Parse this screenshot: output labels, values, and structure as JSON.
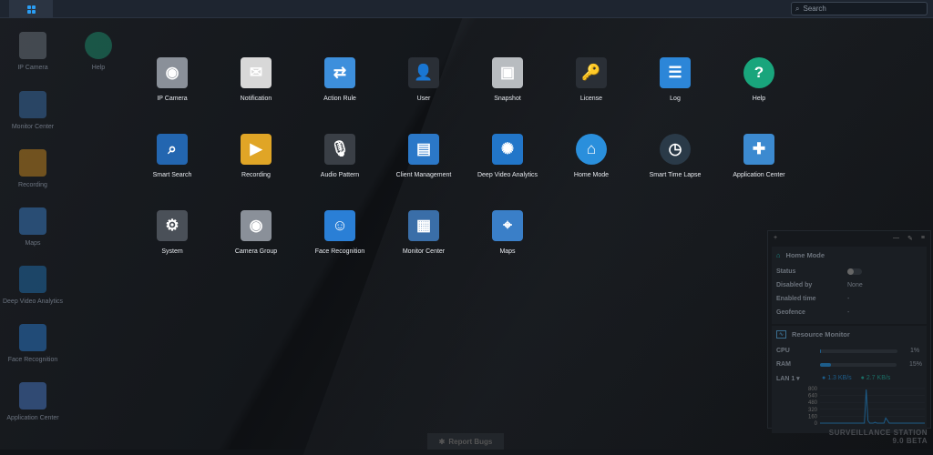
{
  "topbar": {
    "search_placeholder": "Search"
  },
  "desktop": [
    {
      "label": "IP Camera",
      "color": "#6e7680"
    },
    {
      "label": "Help",
      "color": "#1c8f6e"
    },
    {
      "label": "Monitor Center",
      "color": "#3a6ea8"
    },
    {
      "label": "Recording",
      "color": "#c9891e"
    },
    {
      "label": "Maps",
      "color": "#3a7fc8"
    },
    {
      "label": "Deep Video Analytics",
      "color": "#1f6fb0"
    },
    {
      "label": "Face Recognition",
      "color": "#2b7bd0"
    },
    {
      "label": "Application Center",
      "color": "#4a7ac8"
    }
  ],
  "apps": [
    {
      "label": "IP Camera",
      "color": "#8a9099",
      "glyph": "◉"
    },
    {
      "label": "Notification",
      "color": "#d8d8d8",
      "glyph": "✉"
    },
    {
      "label": "Action Rule",
      "color": "#3d8fdc",
      "glyph": "⇄"
    },
    {
      "label": "User",
      "color": "#2a2f36",
      "glyph": "👤"
    },
    {
      "label": "Snapshot",
      "color": "#b8bcc0",
      "glyph": "▣"
    },
    {
      "label": "License",
      "color": "#2a2f36",
      "glyph": "🔑"
    },
    {
      "label": "Log",
      "color": "#2c86d8",
      "glyph": "☰"
    },
    {
      "label": "Help",
      "color": "#19a57c",
      "glyph": "?"
    },
    {
      "label": "Smart Search",
      "color": "#2366b0",
      "glyph": "⌕"
    },
    {
      "label": "Recording",
      "color": "#e0a526",
      "glyph": "▶"
    },
    {
      "label": "Audio Pattern",
      "color": "#3a3f46",
      "glyph": "🎙"
    },
    {
      "label": "Client Management",
      "color": "#2b78c8",
      "glyph": "▤"
    },
    {
      "label": "Deep Video Analytics",
      "color": "#2276c9",
      "glyph": "✺"
    },
    {
      "label": "Home Mode",
      "color": "#2a8fdc",
      "glyph": "⌂"
    },
    {
      "label": "Smart Time Lapse",
      "color": "#2a3a48",
      "glyph": "◷"
    },
    {
      "label": "Application Center",
      "color": "#3c8ad0",
      "glyph": "✚"
    },
    {
      "label": "System",
      "color": "#4a5058",
      "glyph": "⚙"
    },
    {
      "label": "Camera Group",
      "color": "#8a9099",
      "glyph": "◉"
    },
    {
      "label": "Face Recognition",
      "color": "#2a7fd6",
      "glyph": "☺"
    },
    {
      "label": "Monitor Center",
      "color": "#3a6ea8",
      "glyph": "▦"
    },
    {
      "label": "Maps",
      "color": "#3a7fc8",
      "glyph": "⌖"
    }
  ],
  "widget": {
    "home_mode": {
      "title": "Home Mode",
      "rows": [
        {
          "k": "Status",
          "v": ""
        },
        {
          "k": "Disabled by",
          "v": "None"
        },
        {
          "k": "Enabled time",
          "v": "-"
        },
        {
          "k": "Geofence",
          "v": "-"
        }
      ],
      "status_on": false
    },
    "resource": {
      "title": "Resource Monitor",
      "cpu_label": "CPU",
      "cpu": "1%",
      "cpu_pct": 1,
      "ram_label": "RAM",
      "ram": "15%",
      "ram_pct": 15,
      "lan_label": "LAN 1 ▾",
      "up": "1.3 KB/s",
      "down": "2.7 KB/s",
      "chart_data": {
        "type": "line",
        "yticks": [
          "800",
          "640",
          "480",
          "320",
          "160",
          "0"
        ],
        "ylim": [
          0,
          800
        ],
        "values": [
          0,
          0,
          0,
          0,
          0,
          0,
          0,
          0,
          0,
          0,
          0,
          0,
          0,
          0,
          0,
          0,
          0,
          0,
          0,
          0,
          0,
          0,
          0,
          0,
          0,
          0,
          780,
          60,
          0,
          0,
          0,
          20,
          0,
          0,
          0,
          0,
          0,
          120,
          60,
          0,
          0,
          0,
          0,
          0,
          0,
          0,
          0,
          0,
          0,
          0,
          0,
          0,
          0,
          0,
          0,
          0,
          0,
          0,
          0,
          0
        ]
      }
    }
  },
  "report_bugs": "Report Bugs",
  "brand": "SURVEILLANCE STATION 9.0 BETA"
}
